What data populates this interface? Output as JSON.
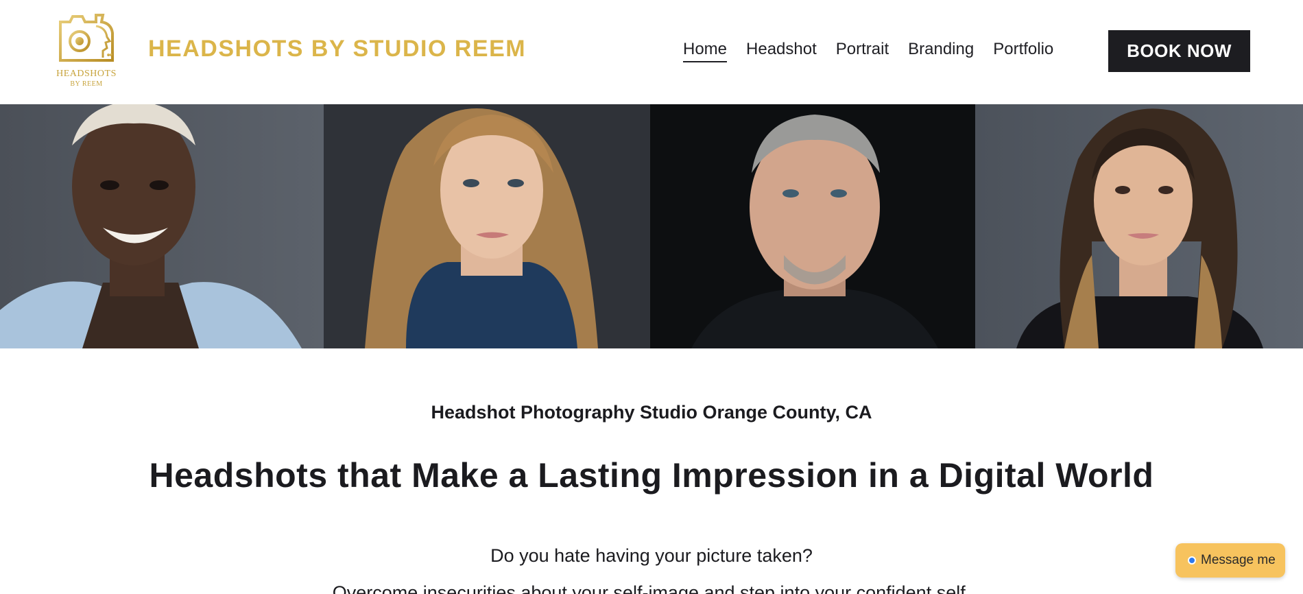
{
  "header": {
    "logo_line1": "HEADSHOTS",
    "logo_line2": "BY REEM",
    "logo_icon": "camera-face-logo-icon",
    "brand_title": "HEADSHOTS BY STUDIO REEM",
    "nav": [
      {
        "label": "Home",
        "active": true
      },
      {
        "label": "Headshot",
        "active": false
      },
      {
        "label": "Portrait",
        "active": false
      },
      {
        "label": "Branding",
        "active": false
      },
      {
        "label": "Portfolio",
        "active": false
      }
    ],
    "cta_label": "BOOK NOW"
  },
  "colors": {
    "brand_gold": "#dbb54a",
    "dark": "#1d1d21",
    "message_bg": "#f7c35e",
    "message_dot": "#2c79f0"
  },
  "intro": {
    "subtitle": "Headshot Photography Studio Orange County, CA",
    "headline": "Headshots that Make a Lasting Impression in a Digital World",
    "question": "Do you hate having your picture taken?",
    "body": "Overcome insecurities about your self-image and step into your confident self."
  },
  "widget": {
    "label": "Message me"
  }
}
